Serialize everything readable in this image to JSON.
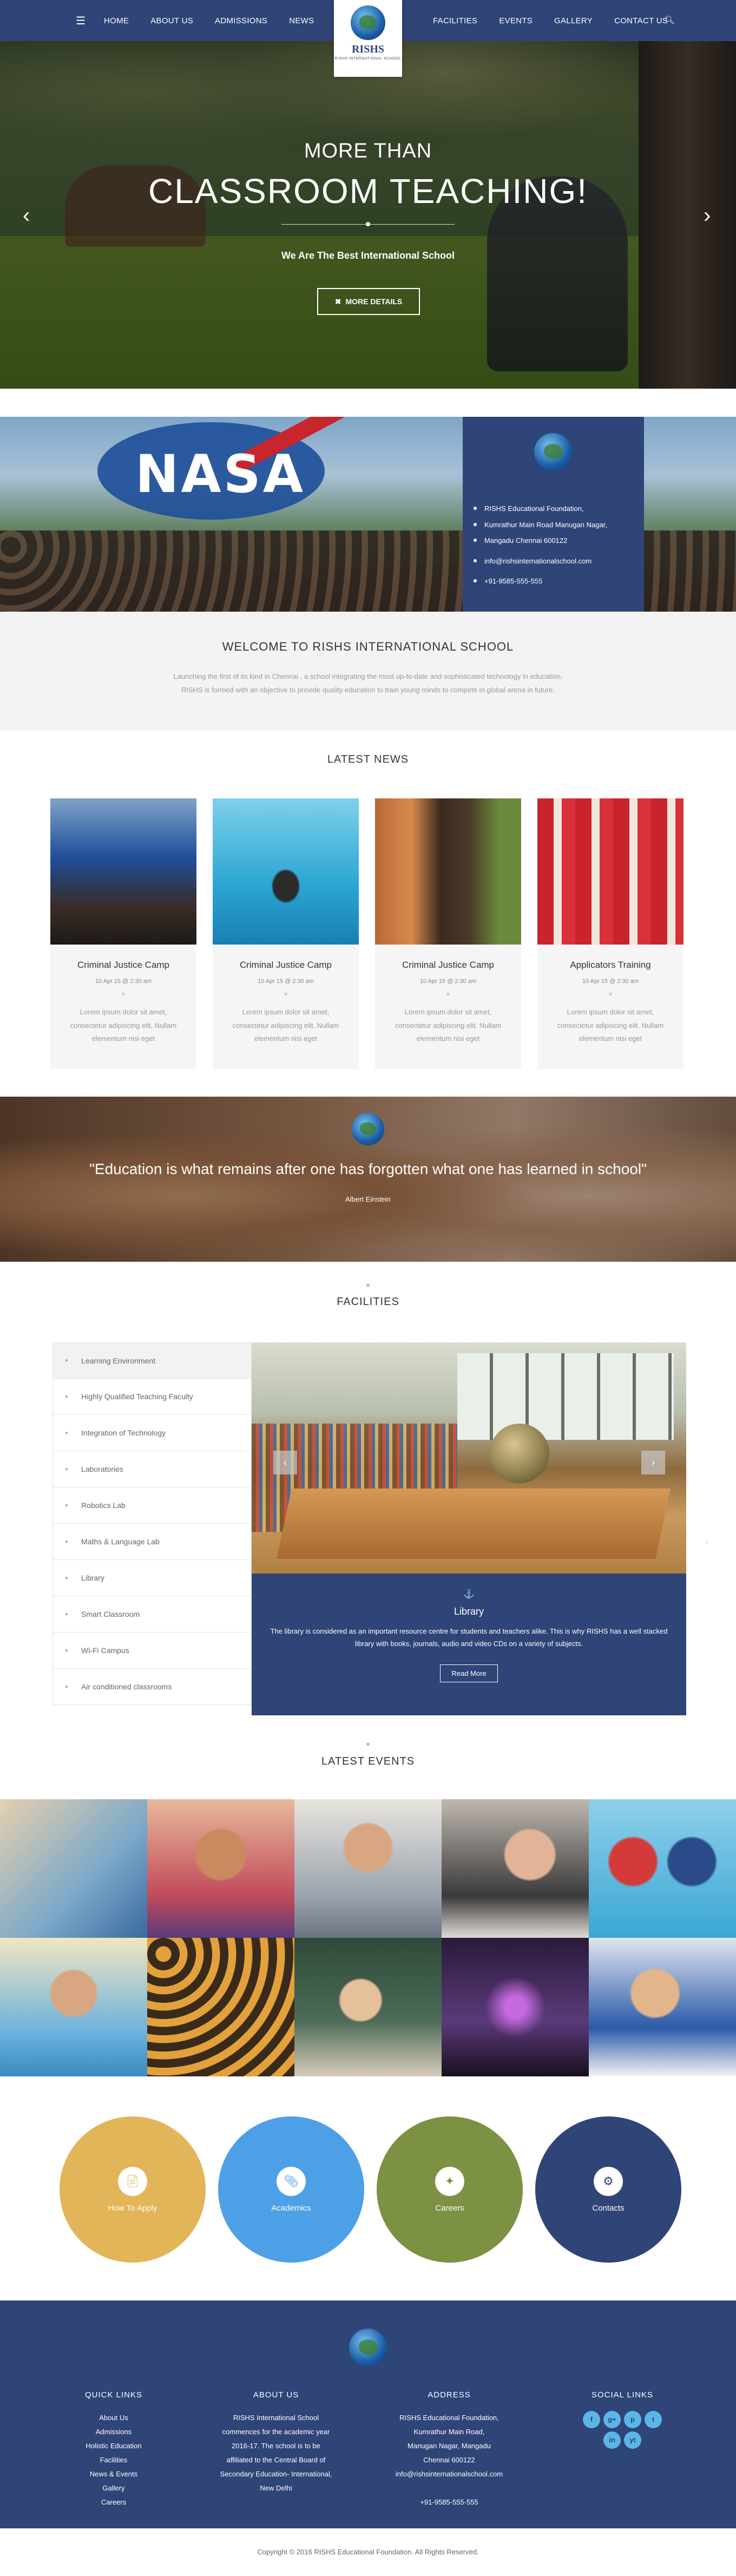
{
  "nav": {
    "left_links": [
      "HOME",
      "ABOUT US",
      "ADMISSIONS",
      "NEWS"
    ],
    "right_links": [
      "FACILITIES",
      "EVENTS",
      "GALLERY",
      "CONTACT US"
    ],
    "logo_name": "RISHS",
    "logo_tag": "RISHS INTERNATIONAL SCHOOL"
  },
  "hero": {
    "pre": "MORE THAN",
    "title": "CLASSROOM TEACHING!",
    "subtitle": "We Are The Best International School",
    "button": "MORE DETAILS"
  },
  "contact_card": {
    "lines": [
      "RISHS Educational Foundation,",
      "Kumrathur Main Road Manugan Nagar,",
      "Mangadu Chennai 600122",
      "info@rishsinternationalschool.com",
      "+91-9585-555-555"
    ]
  },
  "welcome": {
    "title": "WELCOME TO RISHS INTERNATIONAL SCHOOL",
    "line1": "Launching the first of its kind in Chennai , a school integrating the most up-to-date and sophisticated technology in education.",
    "line2": "RISHS is formed with an objective to provide quality education to train young minds to compete in global arena in future."
  },
  "news": {
    "title": "LATEST NEWS",
    "items": [
      {
        "title": "Criminal Justice Camp",
        "date": "10 Apr 15 @ 2:30 am",
        "text": "Lorem ipsum dolor sit amet, consectetur adipiscing elit. Nullam elementum nisi eget"
      },
      {
        "title": "Criminal Justice Camp",
        "date": "10 Apr 15 @ 2:30 am",
        "text": "Lorem ipsum dolor sit amet, consectetur adipiscing elit. Nullam elementum nisi eget"
      },
      {
        "title": "Criminal Justice Camp",
        "date": "10 Apr 15 @ 2:30 am",
        "text": "Lorem ipsum dolor sit amet, consectetur adipiscing elit. Nullam elementum nisi eget"
      },
      {
        "title": "Applicators Training",
        "date": "10 Apr 15 @ 2:30 am",
        "text": "Lorem ipsum dolor sit amet, consectetur adipiscing elit. Nullam elementum nisi eget"
      }
    ]
  },
  "quote": {
    "text": "\"Education is what remains after one has forgotten what one has learned in school\"",
    "author": "Albert Einstein"
  },
  "facilities": {
    "title": "FACILITIES",
    "items": [
      "Learning Environment",
      "Highly Qualified Teaching Faculty",
      "Integration of Technology",
      "Laboratories",
      "Robotics Lab",
      "Maths & Language Lab",
      "Library",
      "Smart Classroom",
      "Wi-Fi Campus",
      "Air conditioned classrooms"
    ],
    "card_title": "Library",
    "card_text": "The library is considered as an important resource centre for students and teachers alike. This is why RISHS has a well stacked library with books, journals, audio and video CDs on a variety of subjects.",
    "card_button": "Read More"
  },
  "events": {
    "title": "LATEST EVENTS"
  },
  "circles": [
    "How To Apply",
    "Academics",
    "Careers",
    "Contacts"
  ],
  "colors": {
    "navy": "#2f4477",
    "yellow": "#e2b559",
    "blue": "#4ea0e6",
    "green": "#7c9142",
    "dark_navy": "#2f4477"
  },
  "footer": {
    "quick_title": "QUICK LINKS",
    "quick_links": [
      "About Us",
      "Admissions",
      "Holistic Education",
      "Facilities",
      "News & Events",
      "Gallery",
      "Careers"
    ],
    "about_title": "ABOUT US",
    "about_lines": [
      "RISHS International School",
      "commences for the academic year",
      "2016-17. The school is to be",
      "affiliated to the Central Board of",
      "Secondary Education- International,",
      "New Delhi"
    ],
    "address_title": "ADDRESS",
    "address_lines": [
      "RISHS Educational Foundation,",
      "Kumrathur Main Road,",
      "Manugan Nagar, Mangadu",
      "Chennai 600122",
      "info@rishsinternationalschool.com",
      "",
      "+91-9585-555-555"
    ],
    "social_title": "SOCIAL LINKS",
    "social_icons": [
      "f",
      "g+",
      "p",
      "t",
      "in",
      "yt"
    ]
  },
  "copyright": "Copyright © 2016 RISHS Educational Foundation. All Rights Reserved."
}
